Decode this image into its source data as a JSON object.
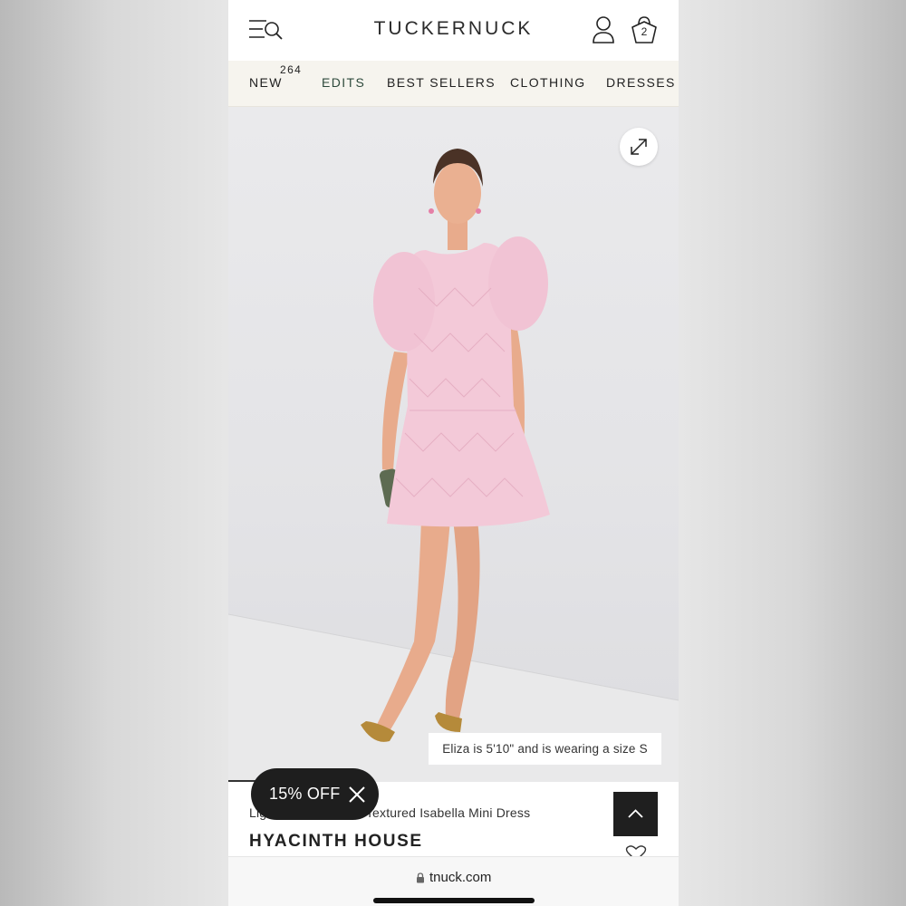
{
  "header": {
    "brand": "TUCKERNUCK",
    "cart_count": "2"
  },
  "nav": {
    "items": [
      {
        "label": "NEW",
        "count": "264"
      },
      {
        "label": "EDITS"
      },
      {
        "label": "BEST SELLERS"
      },
      {
        "label": "CLOTHING"
      },
      {
        "label": "DRESSES"
      }
    ]
  },
  "product": {
    "model_caption": "Eliza is 5'10\" and is wearing a size S",
    "name": "Light Pink Diamond Textured Isabella Mini Dress",
    "designer": "HYACINTH HOUSE"
  },
  "promo": {
    "label": "15% OFF"
  },
  "browser": {
    "url": "tnuck.com"
  },
  "colors": {
    "nav_background": "#f6f4ee",
    "dress_pink": "#f3c9d8",
    "dark_button": "#1f1f1f"
  }
}
